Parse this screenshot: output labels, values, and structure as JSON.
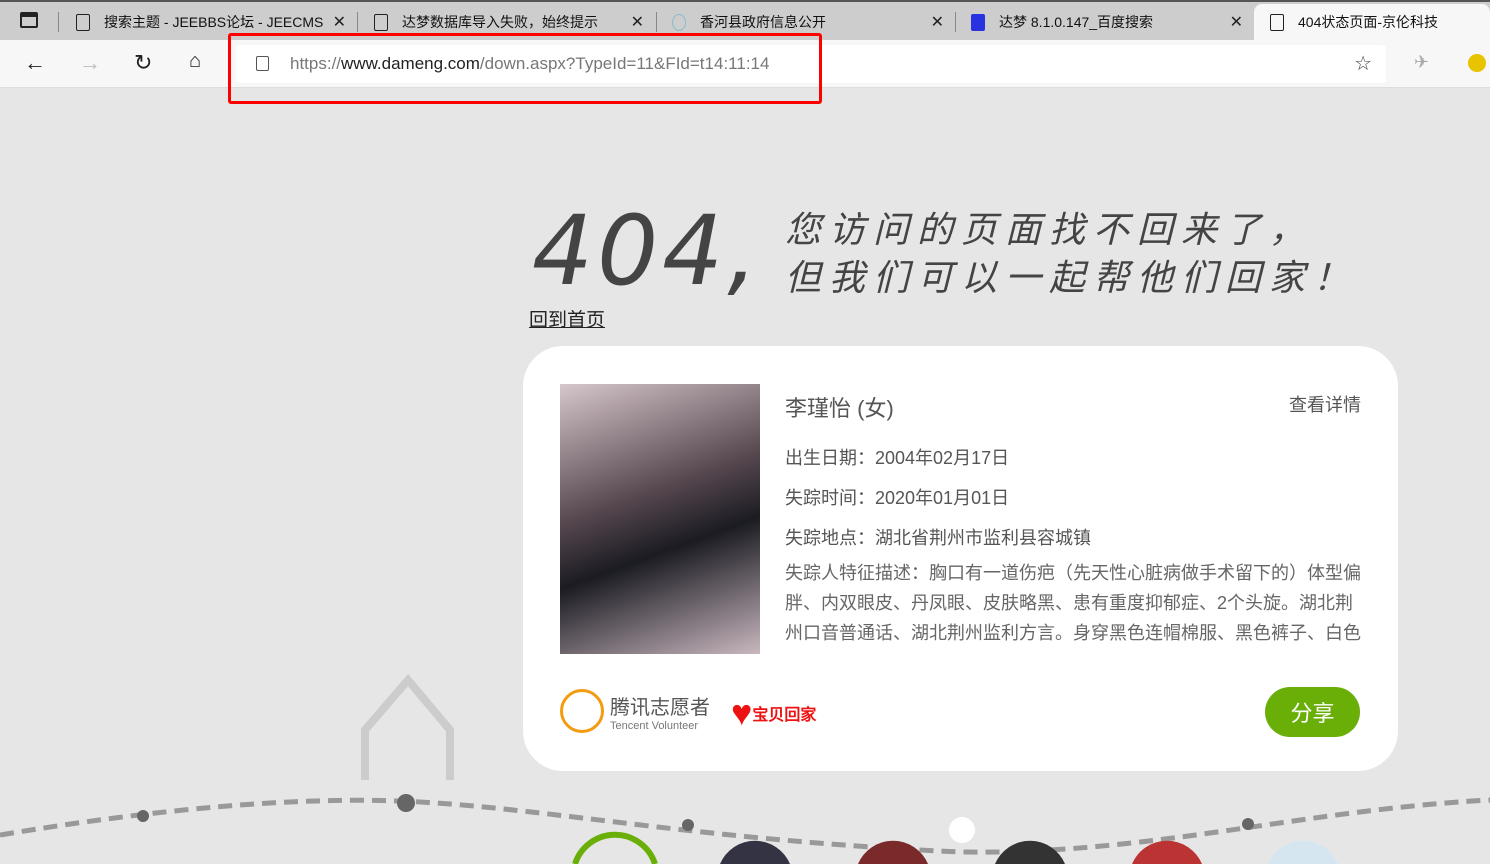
{
  "browser": {
    "tabs": [
      {
        "title": "搜索主题 - JEEBBS论坛 - JEECMS"
      },
      {
        "title": "达梦数据库导入失败，始终提示"
      },
      {
        "title": "香河县政府信息公开"
      },
      {
        "title": "达梦 8.1.0.147_百度搜索"
      },
      {
        "title": "404状态页面-京伦科技"
      }
    ],
    "url_prefix": "https://",
    "url_host": "www.dameng.com",
    "url_path": "/down.aspx?TypeId=11&FId=t14:11:14"
  },
  "page": {
    "code": "404,",
    "message_line1": "您访问的页面找不回来了，",
    "message_line2": "但我们可以一起帮他们回家！",
    "home_link": "回到首页"
  },
  "card": {
    "name": "李瑾怡 (女)",
    "detail_link": "查看详情",
    "birth": "出生日期：2004年02月17日",
    "missing_time": "失踪时间：2020年01月01日",
    "missing_place": "失踪地点：湖北省荆州市监利县容城镇",
    "description": "失踪人特征描述：胸口有一道伤疤（先天性心脏病做手术留下的）体型偏胖、内双眼皮、丹凤眼、皮肤略黑、患有重度抑郁症、2个头旋。湖北荆州口音普通话、湖北荆州监利方言。身穿黑色连帽棉服、黑色裤子、白色运",
    "logo1": "腾讯志愿者",
    "logo1_sub": "Tencent Volunteer",
    "logo2": "宝贝回家",
    "share": "分享"
  },
  "colors": {
    "share": "#6aaf08",
    "highlight": "#ff0000"
  }
}
